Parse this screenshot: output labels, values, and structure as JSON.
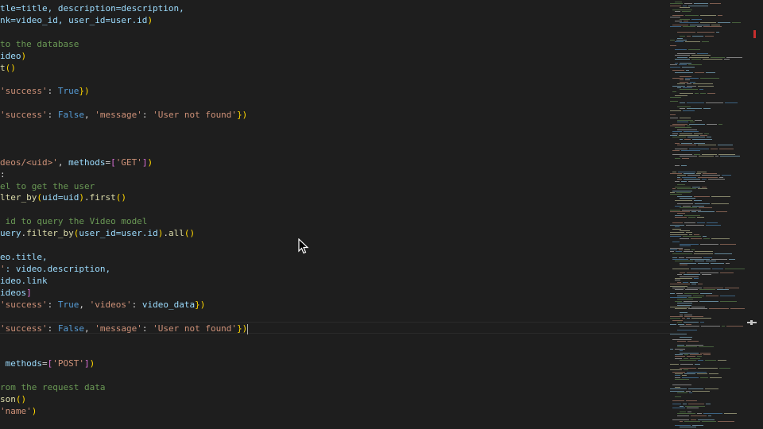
{
  "editor": {
    "lines": [
      {
        "tokens": [
          {
            "t": "tle=title, description=description,",
            "c": "tok-var"
          }
        ]
      },
      {
        "tokens": [
          {
            "t": "nk=video_id, user_id=user.id",
            "c": "tok-var"
          },
          {
            "t": ")",
            "c": "tok-paren"
          }
        ]
      },
      {
        "tokens": []
      },
      {
        "tokens": [
          {
            "t": "to the database",
            "c": "tok-comment"
          }
        ]
      },
      {
        "tokens": [
          {
            "t": "ideo",
            "c": "tok-var"
          },
          {
            "t": ")",
            "c": "tok-paren"
          }
        ]
      },
      {
        "tokens": [
          {
            "t": "t",
            "c": "tok-fn"
          },
          {
            "t": "()",
            "c": "tok-paren"
          }
        ]
      },
      {
        "tokens": []
      },
      {
        "tokens": [
          {
            "t": "'success'",
            "c": "tok-string"
          },
          {
            "t": ": ",
            "c": "tok-plain"
          },
          {
            "t": "True",
            "c": "tok-kw"
          },
          {
            "t": "})",
            "c": "tok-paren"
          }
        ]
      },
      {
        "tokens": []
      },
      {
        "tokens": [
          {
            "t": "'success'",
            "c": "tok-string"
          },
          {
            "t": ": ",
            "c": "tok-plain"
          },
          {
            "t": "False",
            "c": "tok-kw"
          },
          {
            "t": ", ",
            "c": "tok-plain"
          },
          {
            "t": "'message'",
            "c": "tok-string"
          },
          {
            "t": ": ",
            "c": "tok-plain"
          },
          {
            "t": "'User not found'",
            "c": "tok-string"
          },
          {
            "t": "})",
            "c": "tok-paren"
          }
        ]
      },
      {
        "tokens": []
      },
      {
        "tokens": []
      },
      {
        "tokens": []
      },
      {
        "tokens": [
          {
            "t": "deos/<uid>'",
            "c": "tok-string"
          },
          {
            "t": ", ",
            "c": "tok-plain"
          },
          {
            "t": "methods",
            "c": "tok-var"
          },
          {
            "t": "=",
            "c": "tok-plain"
          },
          {
            "t": "[",
            "c": "tok-paren2"
          },
          {
            "t": "'GET'",
            "c": "tok-string"
          },
          {
            "t": "]",
            "c": "tok-paren2"
          },
          {
            "t": ")",
            "c": "tok-paren"
          }
        ]
      },
      {
        "tokens": [
          {
            "t": ":",
            "c": "tok-plain"
          }
        ]
      },
      {
        "tokens": [
          {
            "t": "el to get the user",
            "c": "tok-comment"
          }
        ]
      },
      {
        "tokens": [
          {
            "t": "lter_by",
            "c": "tok-fn"
          },
          {
            "t": "(",
            "c": "tok-paren"
          },
          {
            "t": "uid=uid",
            "c": "tok-var"
          },
          {
            "t": ")",
            "c": "tok-paren"
          },
          {
            "t": ".",
            "c": "tok-plain"
          },
          {
            "t": "first",
            "c": "tok-fn"
          },
          {
            "t": "()",
            "c": "tok-paren"
          }
        ]
      },
      {
        "tokens": []
      },
      {
        "tokens": [
          {
            "t": " id to query the Video model",
            "c": "tok-comment"
          }
        ]
      },
      {
        "tokens": [
          {
            "t": "uery",
            "c": "tok-var"
          },
          {
            "t": ".",
            "c": "tok-plain"
          },
          {
            "t": "filter_by",
            "c": "tok-fn"
          },
          {
            "t": "(",
            "c": "tok-paren"
          },
          {
            "t": "user_id=user.id",
            "c": "tok-var"
          },
          {
            "t": ")",
            "c": "tok-paren"
          },
          {
            "t": ".",
            "c": "tok-plain"
          },
          {
            "t": "all",
            "c": "tok-fn"
          },
          {
            "t": "()",
            "c": "tok-paren"
          }
        ]
      },
      {
        "tokens": []
      },
      {
        "tokens": [
          {
            "t": "eo.title,",
            "c": "tok-var"
          }
        ]
      },
      {
        "tokens": [
          {
            "t": "'",
            "c": "tok-string"
          },
          {
            "t": ": video.description,",
            "c": "tok-var"
          }
        ]
      },
      {
        "tokens": [
          {
            "t": "ideo.link",
            "c": "tok-var"
          }
        ]
      },
      {
        "tokens": [
          {
            "t": "ideos",
            "c": "tok-var"
          },
          {
            "t": "]",
            "c": "tok-paren2"
          }
        ]
      },
      {
        "tokens": [
          {
            "t": "'success'",
            "c": "tok-string"
          },
          {
            "t": ": ",
            "c": "tok-plain"
          },
          {
            "t": "True",
            "c": "tok-kw"
          },
          {
            "t": ", ",
            "c": "tok-plain"
          },
          {
            "t": "'videos'",
            "c": "tok-string"
          },
          {
            "t": ": ",
            "c": "tok-plain"
          },
          {
            "t": "video_data",
            "c": "tok-var"
          },
          {
            "t": "})",
            "c": "tok-paren"
          }
        ]
      },
      {
        "tokens": []
      },
      {
        "tokens": [
          {
            "t": "'success'",
            "c": "tok-string"
          },
          {
            "t": ": ",
            "c": "tok-plain"
          },
          {
            "t": "False",
            "c": "tok-kw"
          },
          {
            "t": ", ",
            "c": "tok-plain"
          },
          {
            "t": "'message'",
            "c": "tok-string"
          },
          {
            "t": ": ",
            "c": "tok-plain"
          },
          {
            "t": "'User not found'",
            "c": "tok-string"
          },
          {
            "t": "})",
            "c": "tok-paren"
          }
        ],
        "current": true
      },
      {
        "tokens": []
      },
      {
        "tokens": []
      },
      {
        "tokens": [
          {
            "t": " methods",
            "c": "tok-var"
          },
          {
            "t": "=",
            "c": "tok-plain"
          },
          {
            "t": "[",
            "c": "tok-paren2"
          },
          {
            "t": "'POST'",
            "c": "tok-string"
          },
          {
            "t": "]",
            "c": "tok-paren2"
          },
          {
            "t": ")",
            "c": "tok-paren"
          }
        ]
      },
      {
        "tokens": []
      },
      {
        "tokens": [
          {
            "t": "rom the request data",
            "c": "tok-comment"
          }
        ]
      },
      {
        "tokens": [
          {
            "t": "son",
            "c": "tok-fn"
          },
          {
            "t": "()",
            "c": "tok-paren"
          }
        ]
      },
      {
        "tokens": [
          {
            "t": "'name'",
            "c": "tok-string"
          },
          {
            "t": ")",
            "c": "tok-paren"
          }
        ]
      }
    ]
  },
  "colors": {
    "background": "#1e1e1e",
    "comment": "#6a9955",
    "string": "#ce9178",
    "function": "#dcdcaa",
    "keyword": "#569cd6",
    "variable": "#9cdcfe",
    "bracket": "#ffd700",
    "scroll_error_marker": "#c72e2e"
  },
  "icons": {
    "mouse_pointer": "arrow-cursor-icon"
  }
}
